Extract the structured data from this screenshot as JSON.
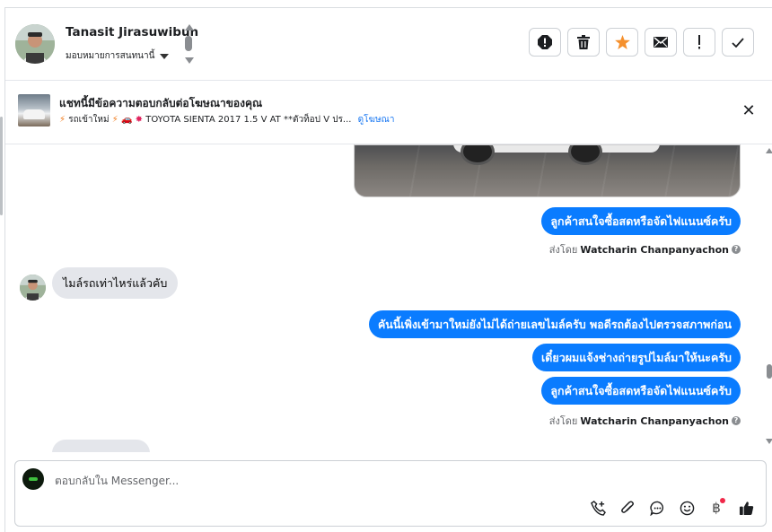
{
  "header": {
    "contact_name": "Tanasit Jirasuwibun",
    "assign_label": "มอบหมายการสนทนานี้",
    "actions": [
      {
        "name": "report-spam-button",
        "icon": "alert-octagon-icon"
      },
      {
        "name": "delete-button",
        "icon": "trash-icon"
      },
      {
        "name": "star-button",
        "icon": "star-icon",
        "color": "#f5902d"
      },
      {
        "name": "mark-unread-button",
        "icon": "envelope-icon"
      },
      {
        "name": "follow-up-button",
        "icon": "exclamation-icon"
      },
      {
        "name": "mark-done-button",
        "icon": "check-icon"
      }
    ]
  },
  "ad_banner": {
    "title": "แชทนี้มีข้อความตอบกลับต่อโฆษณาของคุณ",
    "subtitle": "รถเข้าใหม่ 🚗 TOYOTA SIENTA 2017 1.5 V AT **ตัวท็อป V ปร...",
    "subtitle_prefix": "รถเข้าใหม่",
    "subtitle_text": "TOYOTA SIENTA 2017 1.5 V AT **ตัวท็อป V ปร...",
    "link_label": "ดูโฆษณา"
  },
  "conversation": {
    "messages": [
      {
        "direction": "out",
        "text": "ลูกค้าสนใจซื้อสดหรือจัดไฟแนนซ์ครับ"
      },
      {
        "direction": "meta",
        "sent_by_label": "ส่งโดย",
        "sender": "Watcharin Chanpanyachon"
      },
      {
        "direction": "in",
        "text": "ไมล์รถเท่าไหร่แล้วคับ"
      },
      {
        "direction": "out",
        "text": "คันนี้เพิ่งเข้ามาใหม่ยังไม่ได้ถ่ายเลขไมล์ครับ พอดีรถต้องไปตรวจสภาพก่อน"
      },
      {
        "direction": "out",
        "text": "เดี๋ยวผมแจ้งช่างถ่ายรูปไมล์มาให้นะครับ"
      },
      {
        "direction": "out",
        "text": "ลูกค้าสนใจซื้อสดหรือจัดไฟแนนซ์ครับ"
      },
      {
        "direction": "meta",
        "sent_by_label": "ส่งโดย",
        "sender": "Watcharin Chanpanyachon"
      }
    ]
  },
  "composer": {
    "placeholder": "ตอบกลับใน Messenger...",
    "tools": [
      "add-call-icon",
      "paperclip-icon",
      "saved-reply-icon",
      "emoji-icon",
      "baht-payment-icon",
      "thumbs-up-icon"
    ],
    "baht_symbol": "฿"
  },
  "colors": {
    "accent": "#0a7cff",
    "incoming_bubble": "#e4e6eb",
    "link": "#1877f2",
    "notification_dot": "#f02849"
  }
}
